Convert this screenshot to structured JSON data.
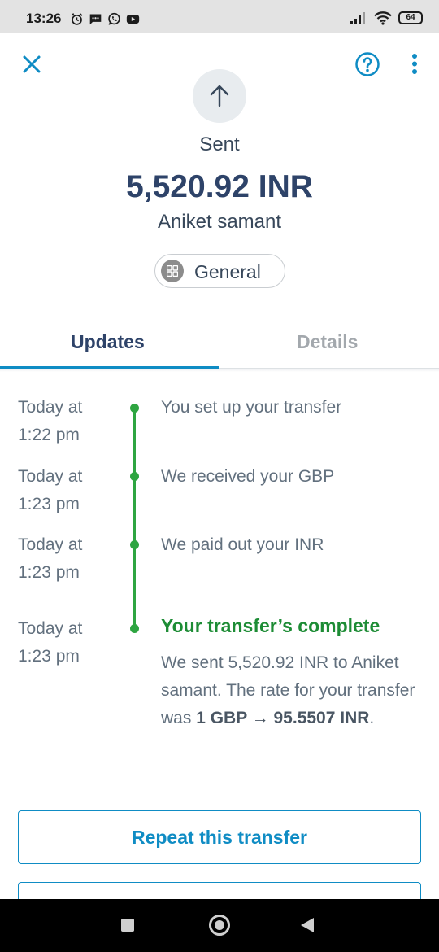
{
  "status_bar": {
    "time": "13:26",
    "battery": "64",
    "left_icons": [
      "alarm-icon",
      "message-icon",
      "whatsapp-icon",
      "youtube-icon"
    ],
    "right_icons": [
      "signal-icon",
      "wifi-icon",
      "battery-icon"
    ]
  },
  "header": {
    "close_icon": "close-icon",
    "help_icon": "help-icon",
    "more_icon": "more-vertical-icon",
    "status_label": "Sent",
    "amount": "5,520.92 INR",
    "recipient": "Aniket samant",
    "category": "General"
  },
  "tabs": [
    {
      "label": "Updates",
      "active": true
    },
    {
      "label": "Details",
      "active": false
    }
  ],
  "timeline": [
    {
      "time_line1": "Today at",
      "time_line2": "1:22 pm",
      "text": "You set up your transfer"
    },
    {
      "time_line1": "Today at",
      "time_line2": "1:23 pm",
      "text": "We received your GBP"
    },
    {
      "time_line1": "Today at",
      "time_line2": "1:23 pm",
      "text": "We paid out your INR"
    },
    {
      "time_line1": "Today at",
      "time_line2": "1:23 pm",
      "title": "Your transfer’s complete",
      "desc_prefix": "We sent 5,520.92 INR to Aniket samant. The rate for your transfer was ",
      "desc_rate": "1 GBP → 95.5507 INR",
      "desc_suffix": "."
    }
  ],
  "actions": {
    "repeat_label": "Repeat this transfer"
  },
  "colors": {
    "accent": "#0f8cc4",
    "amount": "#2e4369",
    "success": "#2ea541",
    "success_text": "#1d8c35"
  }
}
